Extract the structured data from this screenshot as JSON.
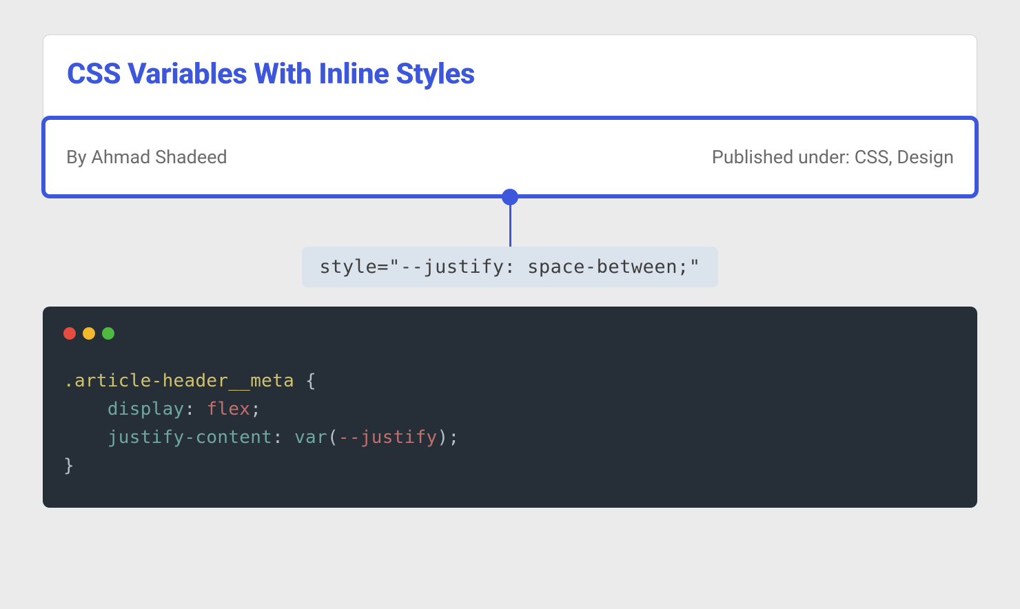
{
  "article": {
    "title": "CSS Variables With Inline Styles",
    "author": "By Ahmad Shadeed",
    "published": "Published under: CSS, Design"
  },
  "annotation": {
    "inline_style": "style=\"--justify: space-between;\""
  },
  "code": {
    "selector": ".article-header__meta",
    "brace_open": " {",
    "line1_prop": "display",
    "line1_colon": ": ",
    "line1_value": "flex",
    "line1_semi": ";",
    "line2_prop": "justify-content",
    "line2_colon": ": ",
    "line2_func": "var",
    "line2_paren_open": "(",
    "line2_var": "--justify",
    "line2_paren_close": ")",
    "line2_semi": ";",
    "brace_close": "}"
  }
}
